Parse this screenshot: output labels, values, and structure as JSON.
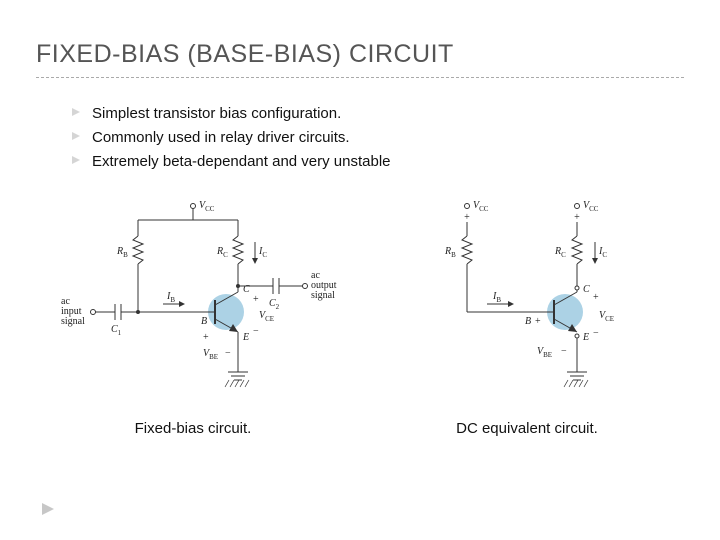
{
  "title": "FIXED-BIAS (BASE-BIAS) CIRCUIT",
  "bullets": [
    "Simplest transistor bias configuration.",
    "Commonly used in relay driver circuits.",
    "Extremely beta-dependant and very unstable"
  ],
  "figures": {
    "left": {
      "caption": "Fixed-bias circuit.",
      "labels": {
        "vcc": "V",
        "vcc_sub": "CC",
        "rb": "R",
        "rb_sub": "B",
        "rc": "R",
        "rc_sub": "C",
        "ic": "I",
        "ic_sub": "C",
        "ib": "I",
        "ib_sub": "B",
        "c1": "C",
        "c1_sub": "1",
        "c2": "C",
        "c2_sub": "2",
        "b": "B",
        "c": "C",
        "e": "E",
        "vce": "V",
        "vce_sub": "CE",
        "vbe": "V",
        "vbe_sub": "BE",
        "ac_in": "ac\ninput\nsignal",
        "ac_out": "ac\noutput\nsignal"
      }
    },
    "right": {
      "caption": "DC equivalent circuit.",
      "labels": {
        "vcc1": "V",
        "vcc1_sub": "CC",
        "vcc2": "V",
        "vcc2_sub": "CC",
        "rb": "R",
        "rb_sub": "B",
        "rc": "R",
        "rc_sub": "C",
        "ic": "I",
        "ic_sub": "C",
        "ib": "I",
        "ib_sub": "B",
        "b": "B",
        "c": "C",
        "e": "E",
        "vce": "V",
        "vce_sub": "CE",
        "vbe": "V",
        "vbe_sub": "BE"
      }
    }
  }
}
